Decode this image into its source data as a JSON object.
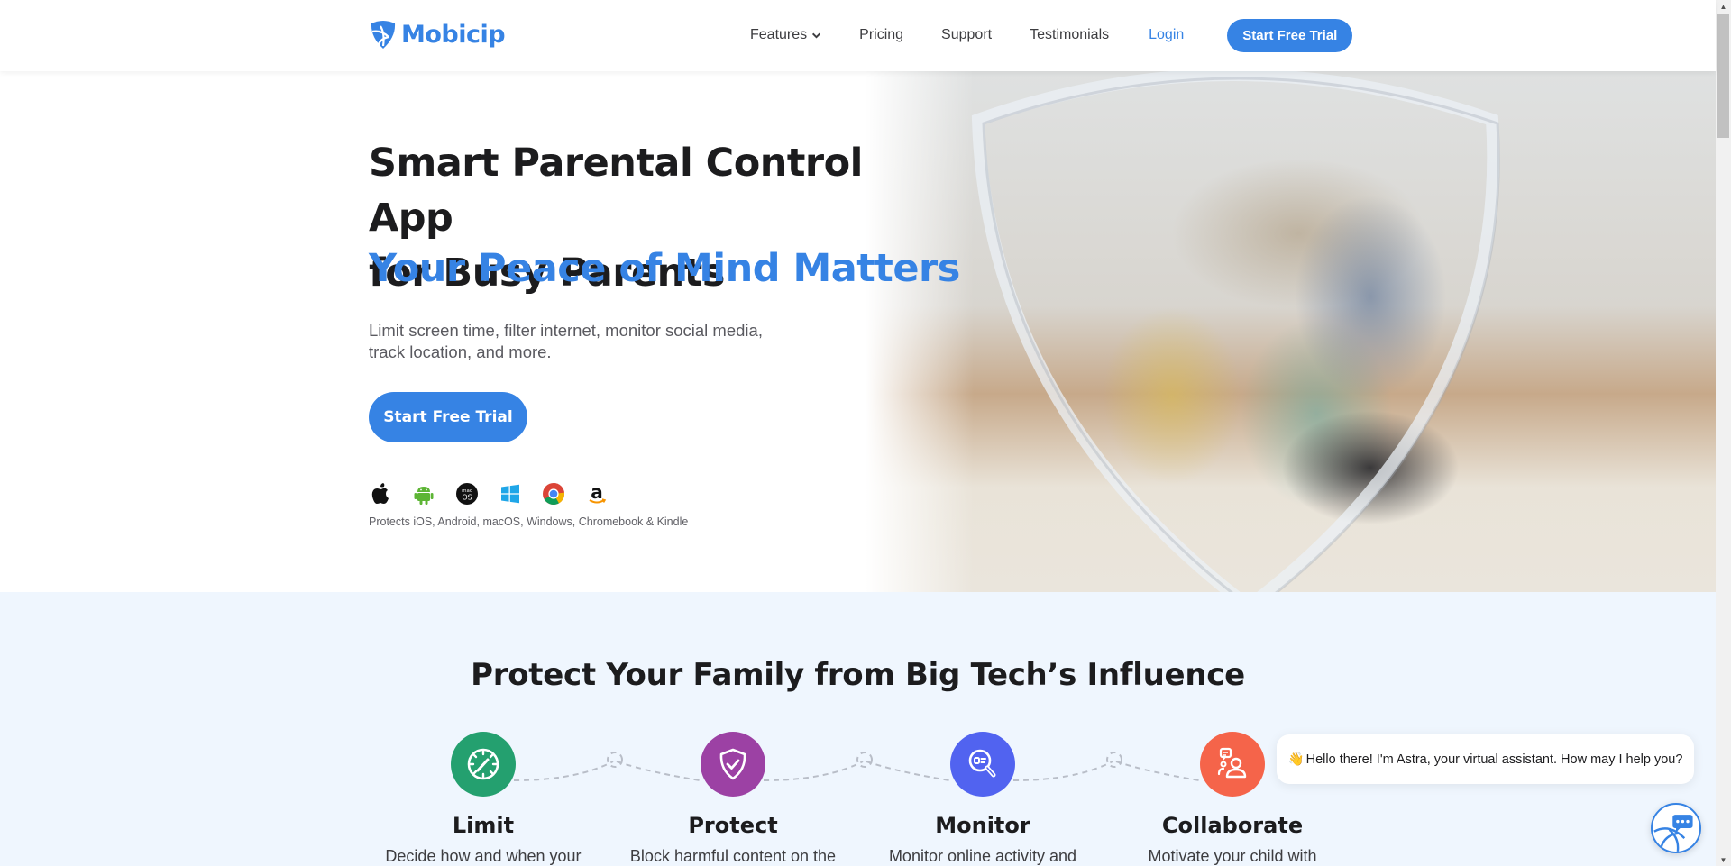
{
  "header": {
    "logo_text": "Mobicip",
    "nav": [
      {
        "label": "Features",
        "has_dropdown": true
      },
      {
        "label": "Pricing"
      },
      {
        "label": "Support"
      },
      {
        "label": "Testimonials"
      }
    ],
    "login_label": "Login",
    "cta_label": "Start Free Trial"
  },
  "hero": {
    "title_line1": "Smart Parental Control App",
    "title_line2": "for Busy Parents",
    "tagline": "Your Peace of Mind Matters",
    "description": "Limit screen time, filter internet, monitor social media, track location, and more.",
    "cta_label": "Start Free Trial",
    "platform_icons": [
      "apple-icon",
      "android-icon",
      "macos-icon",
      "windows-icon",
      "chrome-icon",
      "amazon-icon"
    ],
    "platforms_caption": "Protects iOS, Android, macOS, Windows, Chromebook & Kindle"
  },
  "features_section": {
    "title": "Protect Your Family from Big Tech’s Influence",
    "items": [
      {
        "name": "Limit",
        "desc": "Decide how and when your",
        "icon": "speedometer-icon",
        "color": "#24a06f"
      },
      {
        "name": "Protect",
        "desc": "Block harmful content on the",
        "icon": "shield-check-icon",
        "color": "#9c41a4"
      },
      {
        "name": "Monitor",
        "desc": "Monitor online activity and",
        "icon": "magnifier-icon",
        "color": "#5163f0"
      },
      {
        "name": "Collaborate",
        "desc": "Motivate your child with",
        "icon": "people-chat-icon",
        "color": "#f5644a"
      }
    ]
  },
  "chat": {
    "emoji": "👋",
    "message": "Hello there! I'm Astra, your virtual assistant. How may I help you?"
  },
  "colors": {
    "brand_blue": "#3683e4",
    "section_bg": "#eff6fe",
    "heading": "#1c1c1e"
  }
}
